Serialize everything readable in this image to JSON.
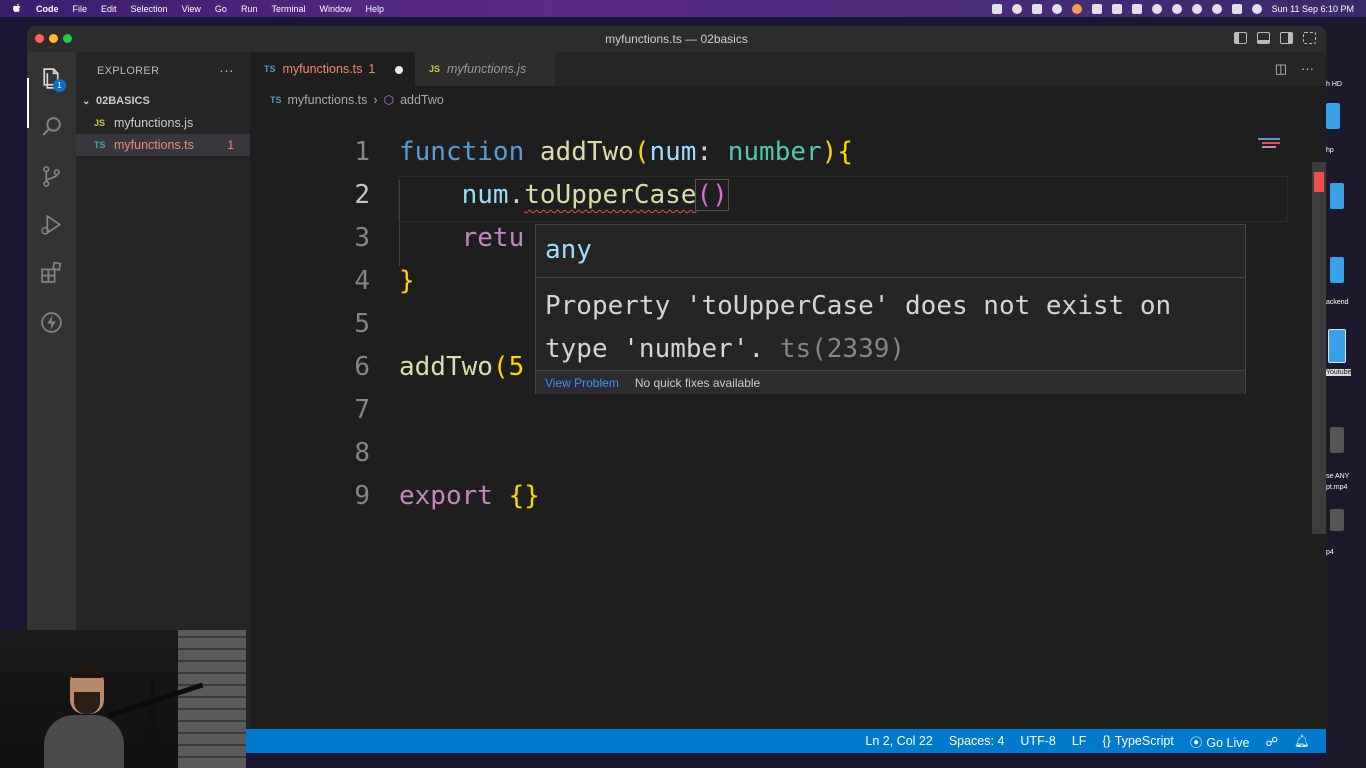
{
  "menubar": {
    "app": "Code",
    "items": [
      "File",
      "Edit",
      "Selection",
      "View",
      "Go",
      "Run",
      "Terminal",
      "Window",
      "Help"
    ],
    "clock": "Sun 11 Sep  6:10 PM"
  },
  "desktop": {
    "labels": [
      "h HD",
      "hp",
      "ackend",
      "Youtube",
      "se ANY",
      "pt.mp4",
      "p4"
    ]
  },
  "window": {
    "title": "myfunctions.ts — 02basics"
  },
  "activitybar": {
    "explorer_badge": "1"
  },
  "sidebar": {
    "header": "EXPLORER",
    "more": "···",
    "folder": "02BASICS",
    "files": [
      {
        "icon": "JS",
        "name": "myfunctions.js",
        "errors": ""
      },
      {
        "icon": "TS",
        "name": "myfunctions.ts",
        "errors": "1"
      }
    ]
  },
  "tabs": [
    {
      "icon": "TS",
      "label": "myfunctions.ts",
      "count": "1",
      "active": true,
      "dirty": true
    },
    {
      "icon": "JS",
      "label": "myfunctions.js",
      "count": "",
      "active": false,
      "dirty": false
    }
  ],
  "breadcrumb": {
    "icon": "TS",
    "file": "myfunctions.ts",
    "symbol": "addTwo"
  },
  "code": {
    "line_numbers": [
      "1",
      "2",
      "3",
      "4",
      "5",
      "6",
      "7",
      "8",
      "9"
    ],
    "l1": {
      "kw": "function",
      "fn": "addTwo",
      "p1": "(",
      "param": "num",
      "colon": ": ",
      "type": "number",
      "p2": ")",
      "brace": "{"
    },
    "l2": {
      "indent": "    ",
      "obj": "num",
      "dot": ".",
      "method": "toUpperCase",
      "parens": "()"
    },
    "l3": {
      "indent": "    ",
      "kw": "retu"
    },
    "l4": {
      "brace": "}"
    },
    "l6": {
      "fn": "addTwo",
      "rest": "(5"
    },
    "l9": {
      "kw": "export",
      "space": " ",
      "brace": "{}"
    }
  },
  "hover": {
    "type": "any",
    "message": "Property 'toUpperCase' does not exist on type 'number'.",
    "code": "ts(2339)",
    "view_problem": "View Problem",
    "no_fixes": "No quick fixes available"
  },
  "statusbar": {
    "position": "Ln 2, Col 22",
    "spaces": "Spaces: 4",
    "encoding": "UTF-8",
    "eol": "LF",
    "language_icon": "{}",
    "language": "TypeScript",
    "golive": "Go Live"
  },
  "colors": {
    "accent": "#007acc",
    "error": "#f14c4c",
    "modified_file": "#f48771"
  }
}
